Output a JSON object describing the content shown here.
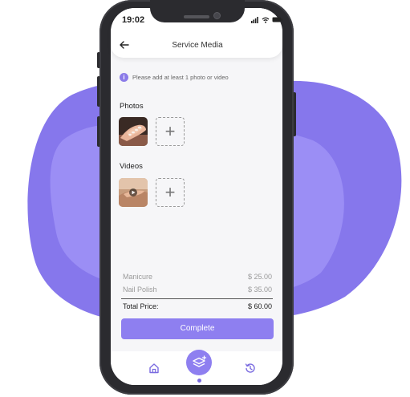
{
  "colors": {
    "accent": "#8e7ff0",
    "blob_dark": "#8677ec",
    "blob_light": "#9b8ef5",
    "phone_frame": "#2b2b2f"
  },
  "status_bar": {
    "time": "19:02",
    "icons": [
      "signal-icon",
      "wifi-icon",
      "battery-icon"
    ]
  },
  "header": {
    "back_icon": "arrow-left-icon",
    "title": "Service Media"
  },
  "hint": {
    "icon": "info-icon",
    "text": "Please add at least 1 photo or video"
  },
  "photos": {
    "label": "Photos",
    "items": [
      {
        "icon": "manicure-photo"
      }
    ],
    "add_icon": "plus-icon"
  },
  "videos": {
    "label": "Videos",
    "items": [
      {
        "icon": "manicure-video",
        "overlay_icon": "play-icon"
      }
    ],
    "add_icon": "plus-icon"
  },
  "summary": {
    "items": [
      {
        "name": "Manicure",
        "price": "$ 25.00"
      },
      {
        "name": "Nail Polish",
        "price": "$ 35.00"
      }
    ],
    "total_label": "Total Price:",
    "total_value": "$ 60.00"
  },
  "complete_button": {
    "label": "Complete"
  },
  "bottom_nav": {
    "items": [
      "home-icon",
      "add-layers-icon",
      "history-icon"
    ],
    "active_index": 1
  }
}
